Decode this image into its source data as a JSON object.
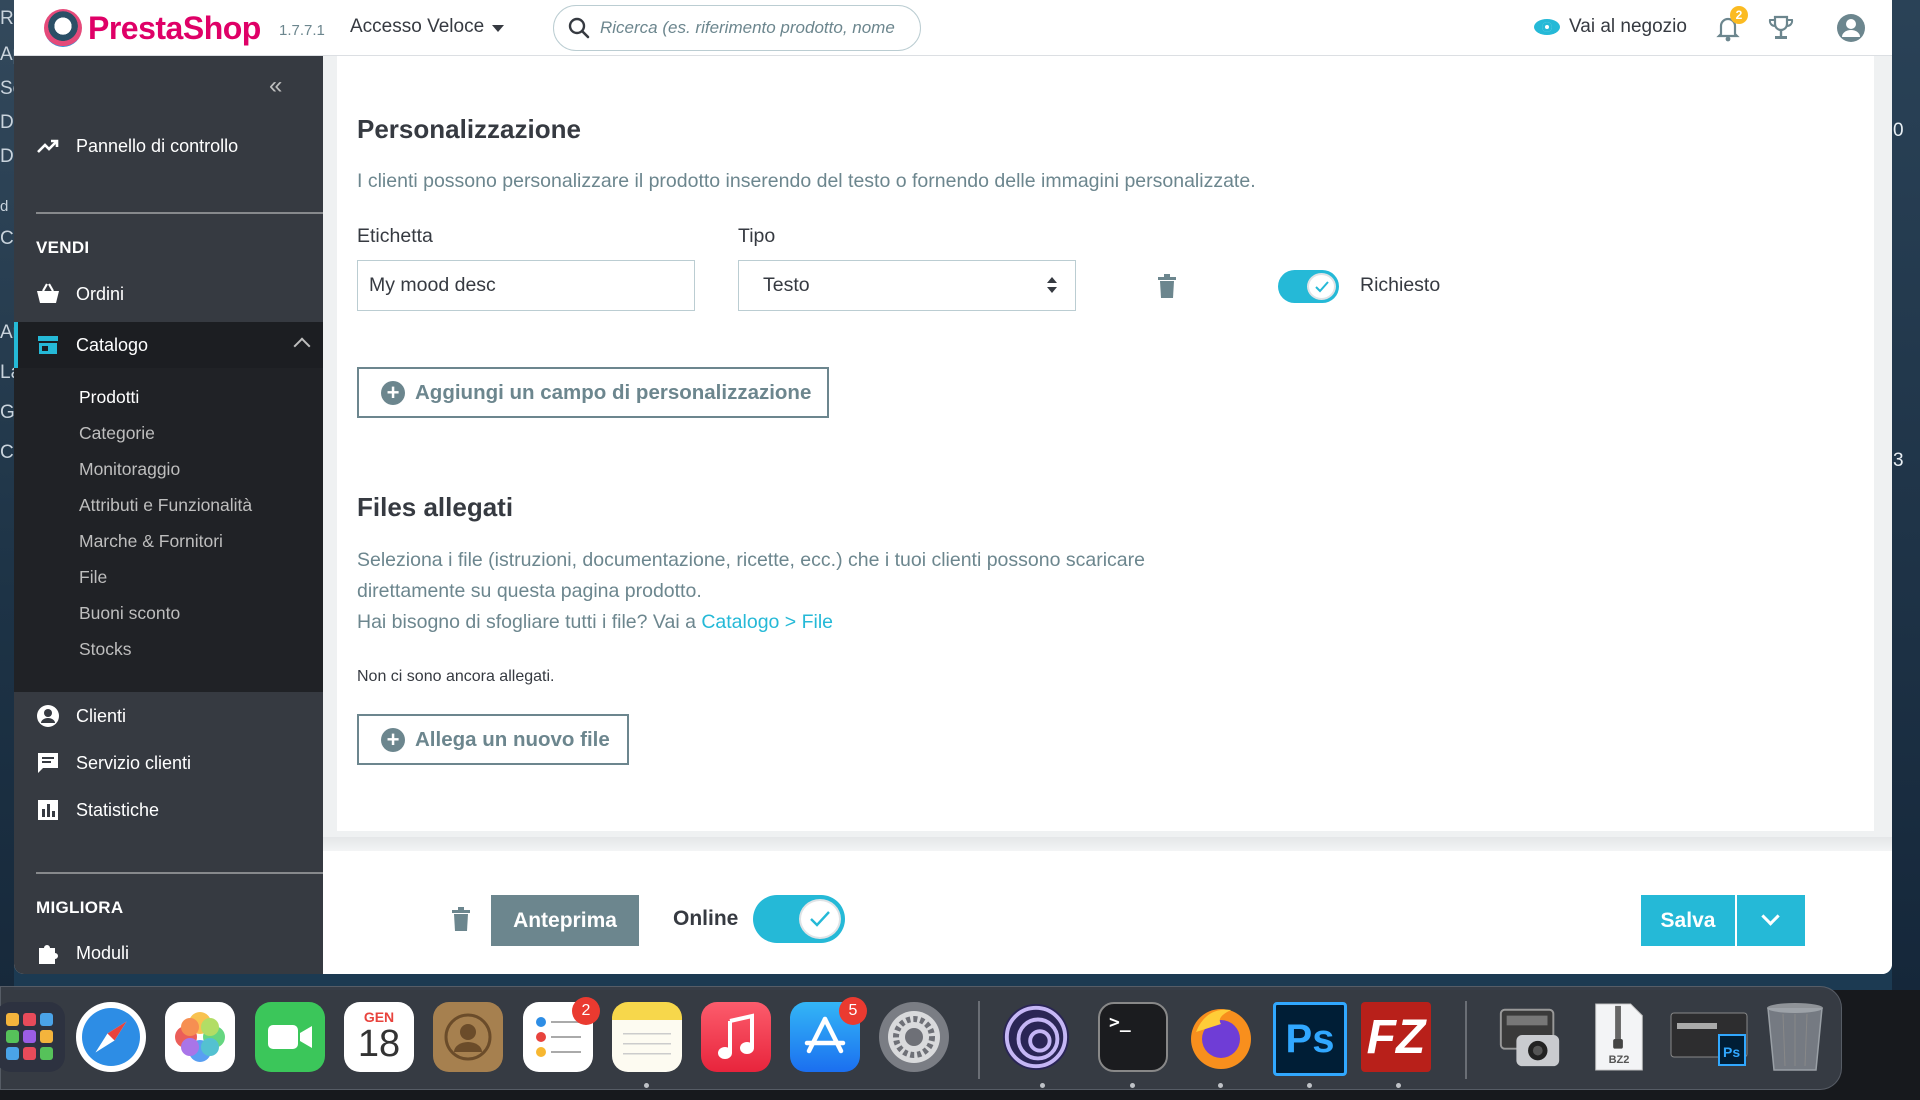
{
  "header": {
    "brand": "PrestaShop",
    "version": "1.7.7.1",
    "quick_access": "Accesso Veloce",
    "search_placeholder": "Ricerca (es. riferimento prodotto, nome",
    "shop_link": "Vai al negozio",
    "notifications_count": "2"
  },
  "sidebar": {
    "dashboard": "Pannello di controllo",
    "section_sell": "VENDI",
    "orders": "Ordini",
    "catalog": "Catalogo",
    "catalog_items": [
      "Prodotti",
      "Categorie",
      "Monitoraggio",
      "Attributi e Funzionalità",
      "Marche & Fornitori",
      "File",
      "Buoni sconto",
      "Stocks"
    ],
    "customers": "Clienti",
    "customer_service": "Servizio clienti",
    "stats": "Statistiche",
    "section_improve": "MIGLIORA",
    "modules": "Moduli"
  },
  "customization": {
    "title": "Personalizzazione",
    "description": "I clienti possono personalizzare il prodotto inserendo del testo o fornendo delle immagini personalizzate.",
    "label_label": "Etichetta",
    "label_value": "My mood desc",
    "type_label": "Tipo",
    "type_value": "Testo",
    "required_label": "Richiesto",
    "required_on": true,
    "add_button": "Aggiungi un campo di personalizzazione"
  },
  "attachments": {
    "title": "Files allegati",
    "description_line1": "Seleziona i file (istruzioni, documentazione, ricette, ecc.) che i tuoi clienti possono scaricare",
    "description_line2": "direttamente su questa pagina prodotto.",
    "browse_prefix": "Hai bisogno di sfogliare tutti i file? Vai a ",
    "browse_link": "Catalogo > File",
    "empty_text": "Non ci sono ancora allegati.",
    "add_button": "Allega un nuovo file"
  },
  "footer": {
    "preview": "Anteprima",
    "online": "Online",
    "online_on": true,
    "save": "Salva"
  },
  "dock": {
    "calendar_month": "GEN",
    "calendar_day": "18",
    "reminders_badge": "2",
    "appstore_badge": "5",
    "ps_label": "Ps",
    "bz2_label": "BZ2"
  },
  "desktop": {
    "left_fragments": [
      "Re",
      "Ap",
      "Sc",
      "Dc",
      "Dc",
      "d",
      "Cl",
      "Ar",
      "La",
      "Gr",
      "Ca"
    ],
    "right_fragments": [
      "0",
      "3"
    ]
  },
  "colors": {
    "accent": "#25b9d7",
    "sidebar": "#363a41",
    "muted": "#6c868e",
    "brand": "#df0067"
  }
}
